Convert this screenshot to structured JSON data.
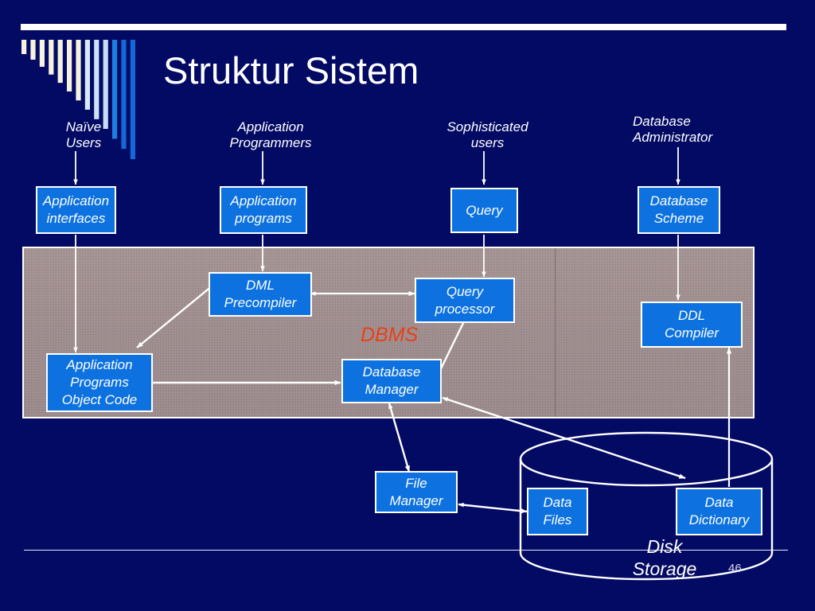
{
  "slide": {
    "title": "Struktur Sistem",
    "page_number": "46",
    "background_color": "#030a63",
    "accent_color": "#0d72e0",
    "dbms_label_color": "#e8401a"
  },
  "decor": {
    "top_bar": "white-rule",
    "bar_colors": [
      "#f7f2de",
      "#f7f2de",
      "#f7f2de",
      "#f7f2de",
      "#f7f2de",
      "#f7f2de",
      "#f7f2de",
      "#d8e8f6",
      "#cfe3f6",
      "#c6def5",
      "#1f7fe0",
      "#1568d8",
      "#1568d8"
    ]
  },
  "actors": [
    {
      "name": "naive-users",
      "label": "Naïve\nUsers"
    },
    {
      "name": "application-programmers",
      "label": "Application\nProgrammers"
    },
    {
      "name": "sophisticated-users",
      "label": "Sophisticated\nusers"
    },
    {
      "name": "database-administrator",
      "label": "Database\nAdministrator"
    }
  ],
  "interface_nodes": [
    {
      "name": "application-interfaces",
      "label": "Application\ninterfaces"
    },
    {
      "name": "application-programs",
      "label": "Application\nprograms"
    },
    {
      "name": "query",
      "label": "Query"
    },
    {
      "name": "database-scheme",
      "label": "Database\nScheme"
    }
  ],
  "dbms": {
    "label": "DBMS",
    "nodes": [
      {
        "name": "dml-precompiler",
        "label": "DML\nPrecompiler"
      },
      {
        "name": "query-processor",
        "label": "Query\nprocessor"
      },
      {
        "name": "ddl-compiler",
        "label": "DDL\nCompiler"
      },
      {
        "name": "application-programs-object-code",
        "label": "Application\nPrograms\nObject Code"
      },
      {
        "name": "database-manager",
        "label": "Database\nManager"
      }
    ]
  },
  "storage": {
    "cylinder_label": "Disk\nStorage",
    "nodes": [
      {
        "name": "file-manager",
        "label": "File\nManager"
      },
      {
        "name": "data-files",
        "label": "Data\nFiles"
      },
      {
        "name": "data-dictionary",
        "label": "Data\nDictionary"
      }
    ]
  },
  "connections": [
    {
      "from": "naive-users",
      "to": "application-interfaces",
      "style": "arrow"
    },
    {
      "from": "application-programmers",
      "to": "application-programs",
      "style": "arrow"
    },
    {
      "from": "sophisticated-users",
      "to": "query",
      "style": "arrow"
    },
    {
      "from": "database-administrator",
      "to": "database-scheme",
      "style": "arrow"
    },
    {
      "from": "application-interfaces",
      "to": "application-programs-object-code",
      "style": "arrow"
    },
    {
      "from": "application-programs",
      "to": "dml-precompiler",
      "style": "arrow"
    },
    {
      "from": "query",
      "to": "query-processor",
      "style": "arrow"
    },
    {
      "from": "database-scheme",
      "to": "ddl-compiler",
      "style": "arrow"
    },
    {
      "from": "dml-precompiler",
      "to": "query-processor",
      "style": "double-arrow"
    },
    {
      "from": "dml-precompiler",
      "to": "application-programs-object-code",
      "style": "arrow"
    },
    {
      "from": "application-programs-object-code",
      "to": "database-manager",
      "style": "arrow"
    },
    {
      "from": "query-processor",
      "to": "database-manager",
      "style": "arrow"
    },
    {
      "from": "data-dictionary",
      "to": "database-manager",
      "style": "arrow"
    },
    {
      "from": "database-manager",
      "to": "data-dictionary",
      "style": "arrow"
    },
    {
      "from": "database-manager",
      "to": "file-manager",
      "style": "arrow"
    },
    {
      "from": "file-manager",
      "to": "data-files",
      "style": "double-arrow"
    },
    {
      "from": "ddl-compiler",
      "to": "data-dictionary",
      "style": "arrow"
    }
  ]
}
